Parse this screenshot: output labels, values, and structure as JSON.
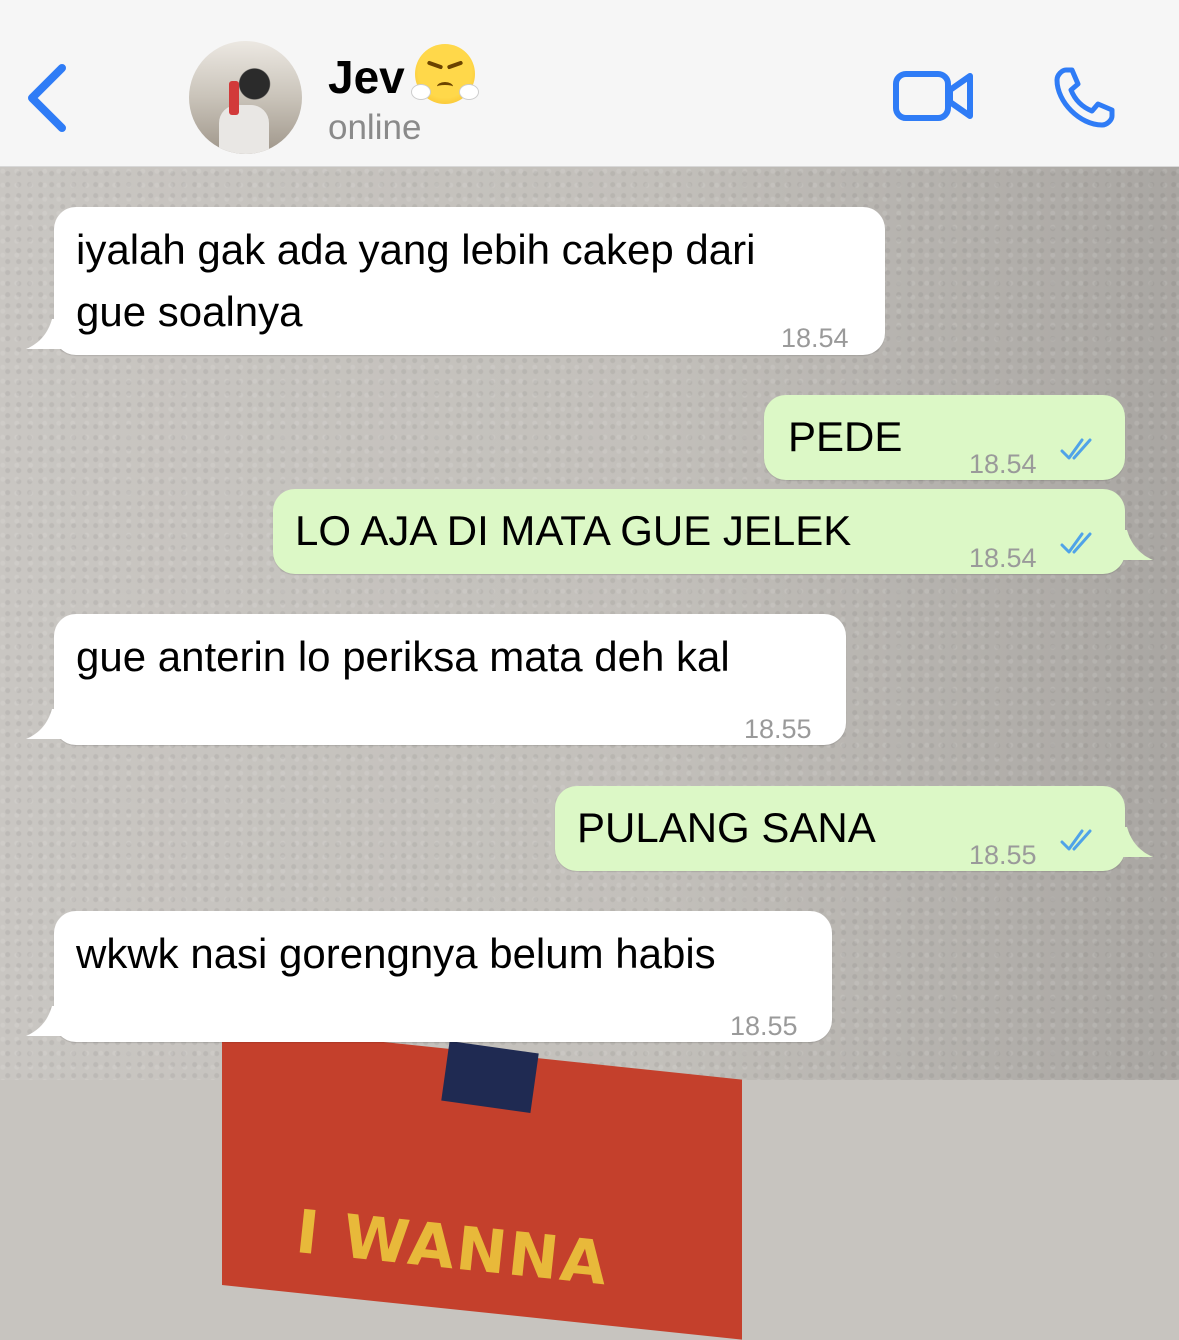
{
  "header": {
    "contact_name": "Jev",
    "status": "online",
    "back_icon": "chevron-left-icon",
    "video_icon": "video-camera-icon",
    "call_icon": "phone-icon",
    "accent_color": "#2f7cf6"
  },
  "messages": [
    {
      "direction": "in",
      "lines": [
        "iyalah gak ada yang lebih cakep dari",
        "gue soalnya"
      ],
      "time": "18.54"
    },
    {
      "direction": "out",
      "lines": [
        "PEDE"
      ],
      "time": "18.54",
      "read": true
    },
    {
      "direction": "out",
      "lines": [
        "LO AJA DI MATA GUE JELEK"
      ],
      "time": "18.54",
      "read": true
    },
    {
      "direction": "in",
      "lines": [
        "gue anterin lo periksa mata deh kal"
      ],
      "time": "18.55"
    },
    {
      "direction": "out",
      "lines": [
        "PULANG SANA"
      ],
      "time": "18.55",
      "read": true
    },
    {
      "direction": "in",
      "lines": [
        "wkwk nasi gorengnya belum habis"
      ],
      "time": "18.55"
    }
  ],
  "background_text": "I WANNA"
}
